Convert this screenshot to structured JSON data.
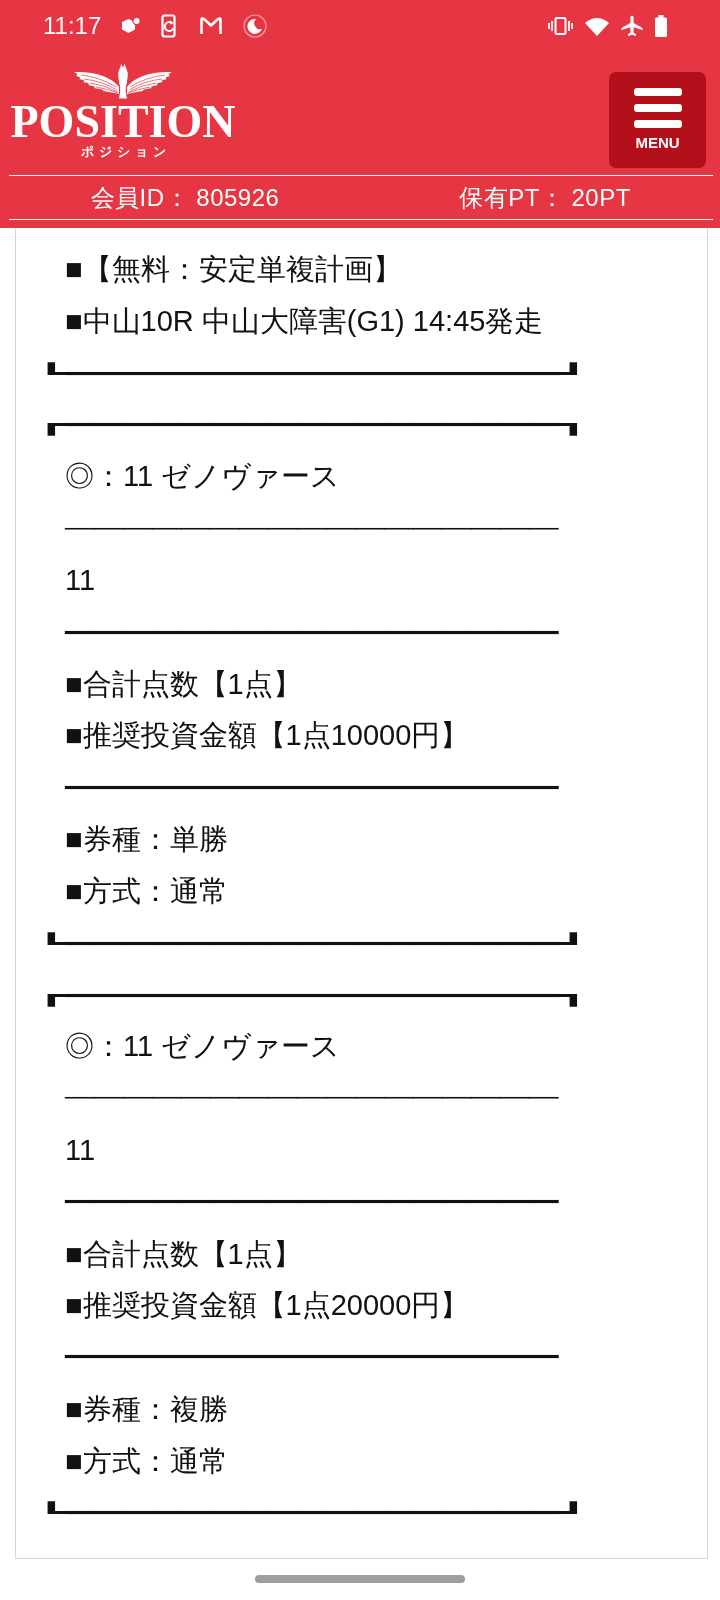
{
  "status_bar": {
    "time": "11:17"
  },
  "header": {
    "logo": {
      "wordmark": "POSITION",
      "tagline": "ポジション"
    },
    "menu_button": {
      "label": "MENU"
    },
    "member_id": "会員ID： 805926",
    "points": "保有PT： 20PT"
  },
  "content": {
    "blocks": [
      {
        "lines": [
          {
            "kind": "text",
            "text": "■【無料：安定単複計画】"
          },
          {
            "kind": "text",
            "text": "■中山10R 中山大障害(G1) 14:45発走"
          },
          {
            "kind": "frame",
            "text": "┗━━━━━━━━━━━━━━━━━┛"
          }
        ]
      },
      {
        "lines": [
          {
            "kind": "frame",
            "text": "┏━━━━━━━━━━━━━━━━━┓"
          },
          {
            "kind": "text",
            "text": "◎：11 ゼノヴァース"
          },
          {
            "kind": "rule",
            "text": "─────────────────"
          },
          {
            "kind": "text",
            "text": "11"
          },
          {
            "kind": "rule",
            "text": "━━━━━━━━━━━━━━━━━"
          },
          {
            "kind": "text",
            "text": "■合計点数【1点】"
          },
          {
            "kind": "text",
            "text": "■推奨投資金額【1点10000円】"
          },
          {
            "kind": "rule",
            "text": "━━━━━━━━━━━━━━━━━"
          },
          {
            "kind": "text",
            "text": "■券種：単勝"
          },
          {
            "kind": "text",
            "text": "■方式：通常"
          },
          {
            "kind": "frame",
            "text": "┗━━━━━━━━━━━━━━━━━┛"
          }
        ]
      },
      {
        "lines": [
          {
            "kind": "frame",
            "text": "┏━━━━━━━━━━━━━━━━━┓"
          },
          {
            "kind": "text",
            "text": "◎：11 ゼノヴァース"
          },
          {
            "kind": "rule",
            "text": "─────────────────"
          },
          {
            "kind": "text",
            "text": "11"
          },
          {
            "kind": "rule",
            "text": "━━━━━━━━━━━━━━━━━"
          },
          {
            "kind": "text",
            "text": "■合計点数【1点】"
          },
          {
            "kind": "text",
            "text": "■推奨投資金額【1点20000円】"
          },
          {
            "kind": "rule",
            "text": "━━━━━━━━━━━━━━━━━"
          },
          {
            "kind": "text",
            "text": "■券種：複勝"
          },
          {
            "kind": "text",
            "text": "■方式：通常"
          },
          {
            "kind": "frame",
            "text": "┗━━━━━━━━━━━━━━━━━┛"
          }
        ]
      }
    ]
  }
}
